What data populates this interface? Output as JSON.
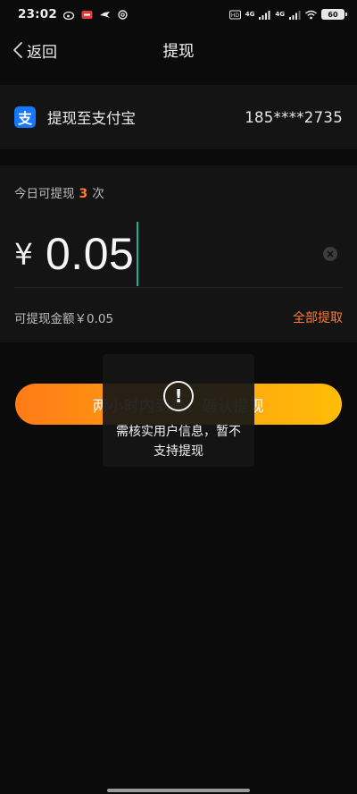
{
  "status_bar": {
    "time": "23:02",
    "network_1": "4G",
    "network_2": "4G",
    "battery": "60"
  },
  "nav": {
    "back_label": "返回",
    "title": "提现"
  },
  "account": {
    "label": "提现至支付宝",
    "value": "185****2735",
    "logo_char": "支"
  },
  "amount_card": {
    "today_prefix": "今日可提现",
    "today_count": "3",
    "today_suffix": "次",
    "currency": "¥",
    "amount": "0.05",
    "available_text": "可提现金额￥0.05",
    "withdraw_all_label": "全部提取"
  },
  "confirm": {
    "label": "两小时内到账，确认提现"
  },
  "toast": {
    "icon": "!",
    "message": "需核实用户信息，暂不支持提现"
  },
  "colors": {
    "accent": "#ff7a33",
    "button_gradient_start": "#ff7b17",
    "button_gradient_end": "#ffbc08",
    "alipay_blue": "#1677ff",
    "cursor": "#14b39a"
  }
}
